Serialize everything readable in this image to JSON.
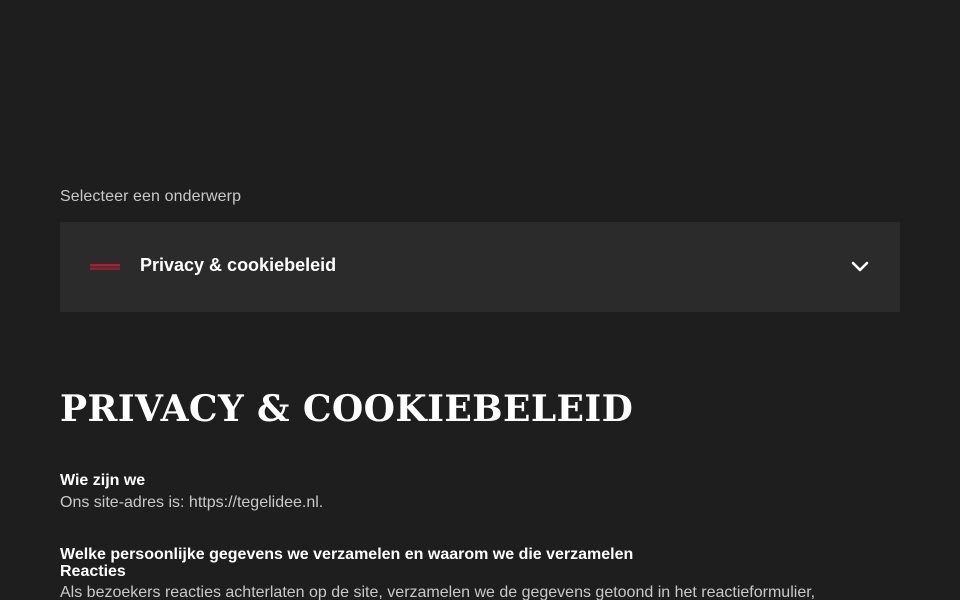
{
  "selector": {
    "label": "Selecteer een onderwerp",
    "selected_value": "Privacy & cookiebeleid",
    "flag_icon": "flag-icon",
    "chevron_icon": "chevron-down-icon"
  },
  "main": {
    "title": "PRIVACY & COOKIEBELEID",
    "sections": [
      {
        "heading": "Wie zijn we",
        "text": "Ons site-adres is: https://tegelidee.nl."
      },
      {
        "heading": "Welke persoonlijke gegevens we verzamelen en waarom we die verzamelen",
        "subheading": "Reacties",
        "text": "Als bezoekers reacties achterlaten op de site, verzamelen we de gegevens getoond in het reactieformulier,"
      }
    ]
  },
  "colors": {
    "background": "#1e1e1e",
    "select_background": "#2b2b2b",
    "muted_text": "#c9c9c9",
    "flag_accent": "#c8102e"
  }
}
